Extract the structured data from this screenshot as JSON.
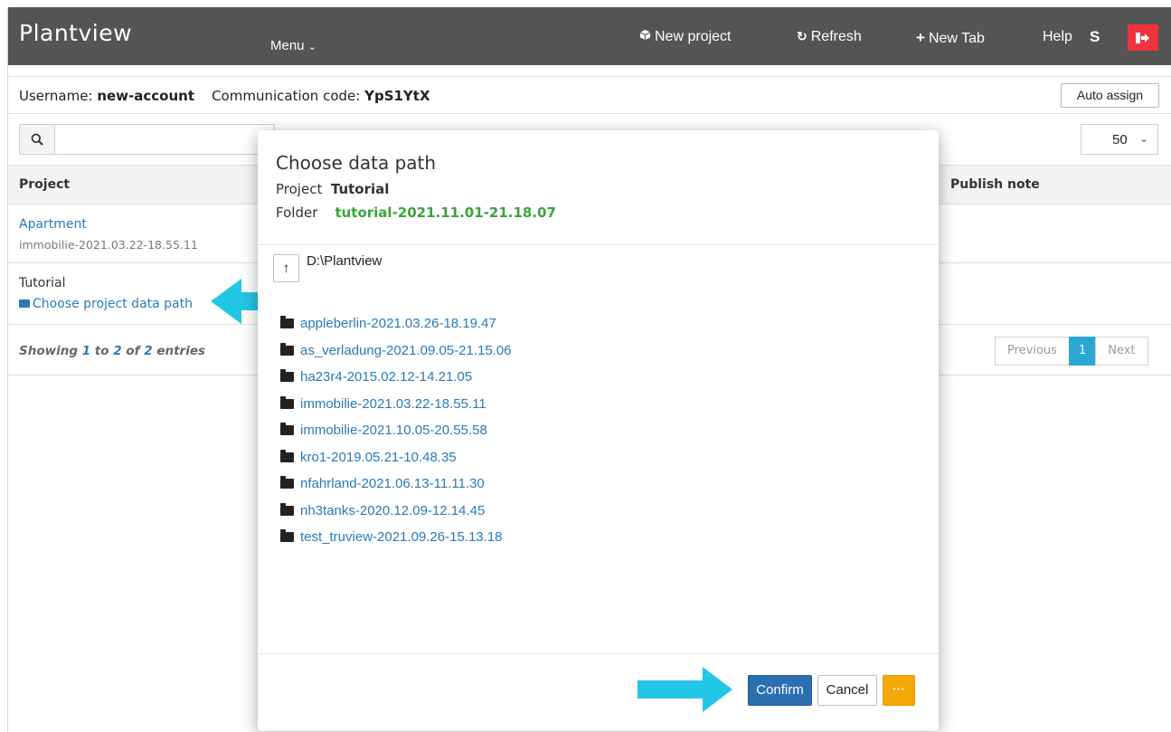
{
  "app": {
    "title": "Plantview"
  },
  "navbar": {
    "menu_label": "Menu",
    "new_project_label": "New project",
    "refresh_label": "Refresh",
    "new_tab_label": "New Tab",
    "help_label": "Help",
    "user_initial": "S",
    "colors": {
      "bar": "#545454",
      "logout": "#f0323c"
    }
  },
  "info": {
    "username_label": "Username:",
    "username_value": "new-account",
    "code_label": "Communication code:",
    "code_value": "YpS1YtX",
    "auto_assign_label": "Auto assign"
  },
  "search": {
    "placeholder": ""
  },
  "page_size": {
    "selected": "50"
  },
  "table": {
    "headers": {
      "project": "Project",
      "publish_note": "Publish note"
    },
    "rows": [
      {
        "name": "Apartment",
        "sub": "immobilie-2021.03.22-18.55.11"
      },
      {
        "name": "Tutorial",
        "sub": "Choose project data path"
      }
    ],
    "showing": {
      "prefix": "Showing",
      "from": "1",
      "to_word": "to",
      "to": "2",
      "of_word": "of",
      "total": "2",
      "suffix": "entries"
    },
    "pager": {
      "previous": "Previous",
      "current": "1",
      "next": "Next"
    }
  },
  "modal": {
    "title": "Choose data path",
    "project_label": "Project",
    "project_value": "Tutorial",
    "folder_label": "Folder",
    "folder_value": "tutorial-2021.11.01-21.18.07",
    "up_label": "↑",
    "current_path": "D:\\Plantview",
    "folders": [
      "appleberlin-2021.03.26-18.19.47",
      "as_verladung-2021.09.05-21.15.06",
      "ha23r4-2015.02.12-14.21.05",
      "immobilie-2021.03.22-18.55.11",
      "immobilie-2021.10.05-20.55.58",
      "kro1-2019.05.21-10.48.35",
      "nfahrland-2021.06.13-11.11.30",
      "nh3tanks-2020.12.09-12.14.45",
      "test_truview-2021.09.26-15.13.18"
    ],
    "confirm_label": "Confirm",
    "cancel_label": "Cancel",
    "more_label": "···"
  },
  "annotation": {
    "arrow_color": "#22c7e8"
  }
}
